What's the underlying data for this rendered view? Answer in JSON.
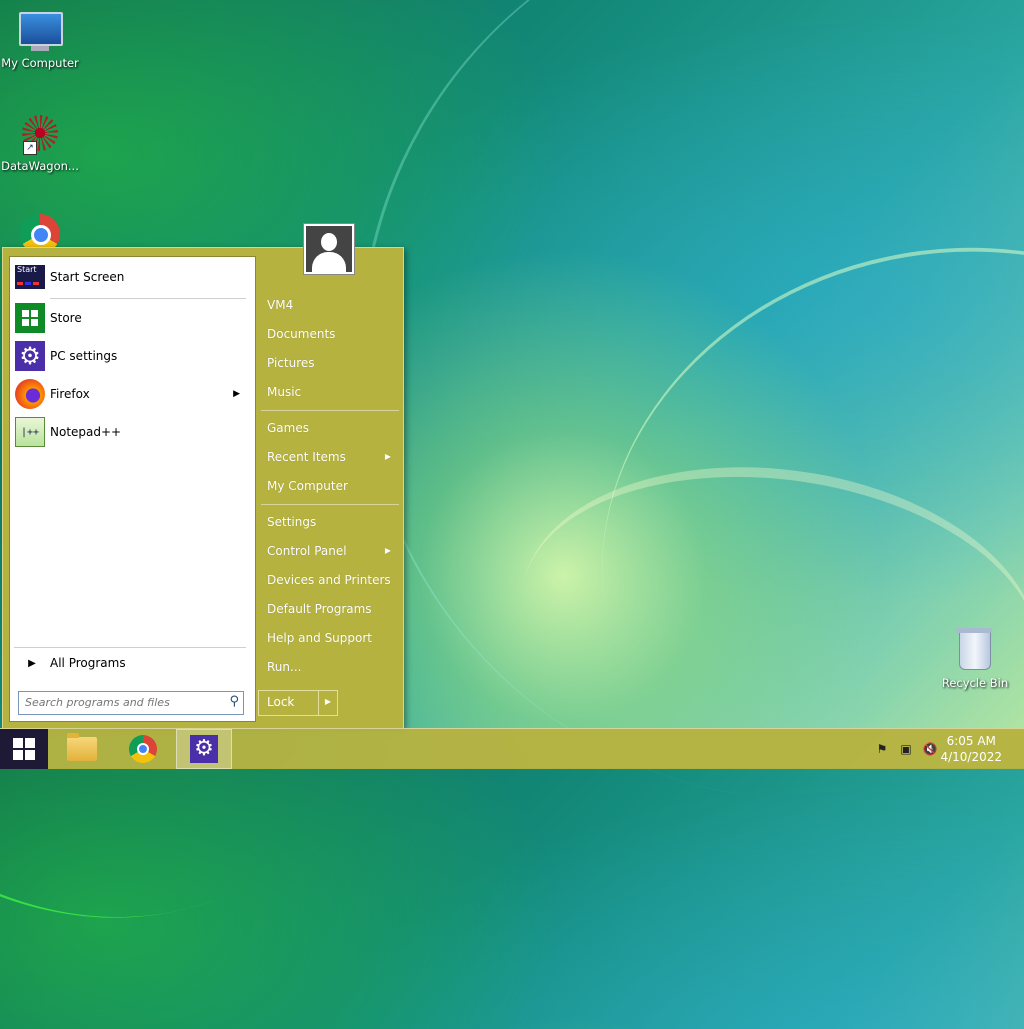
{
  "desktop": {
    "icons": [
      {
        "label": "My Computer"
      },
      {
        "label": "DataWagon..."
      },
      {
        "label": ""
      },
      {
        "label": "Recycle Bin"
      }
    ]
  },
  "start_menu": {
    "left": {
      "items": [
        {
          "label": "Start Screen",
          "icon": "start-screen-icon"
        },
        {
          "label": "Store",
          "icon": "store-icon"
        },
        {
          "label": "PC settings",
          "icon": "gear-icon"
        },
        {
          "label": "Firefox",
          "icon": "firefox-icon",
          "has_submenu": true
        },
        {
          "label": "Notepad++",
          "icon": "notepad-plus-plus-icon"
        }
      ],
      "start_icon_text": "Start",
      "notepad_icon_text": "|++",
      "all_programs": "All Programs",
      "search_placeholder": "Search programs and files"
    },
    "right": {
      "items": [
        {
          "label": "VM4"
        },
        {
          "label": "Documents"
        },
        {
          "label": "Pictures"
        },
        {
          "label": "Music"
        },
        {
          "label": "Games"
        },
        {
          "label": "Recent Items",
          "has_submenu": true
        },
        {
          "label": "My Computer"
        },
        {
          "label": "Settings"
        },
        {
          "label": "Control Panel",
          "has_submenu": true
        },
        {
          "label": "Devices and Printers"
        },
        {
          "label": "Default Programs"
        },
        {
          "label": "Help and Support"
        },
        {
          "label": "Run..."
        }
      ],
      "lock_label": "Lock"
    }
  },
  "taskbar": {
    "pinned": [
      "file-explorer-icon",
      "chrome-icon",
      "settings-icon"
    ],
    "tray": [
      "action-center-flag-icon",
      "network-icon",
      "volume-muted-icon"
    ],
    "time": "6:05 AM",
    "date": "4/10/2022"
  },
  "colors": {
    "menu_bg": "#b6b23f",
    "start_button": "#1e1a36",
    "settings_purple": "#4a2fa8"
  }
}
